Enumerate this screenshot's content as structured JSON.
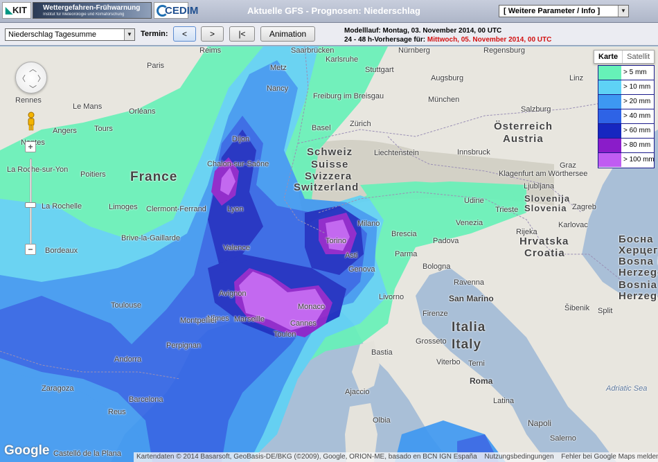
{
  "header": {
    "logo_kit": "KIT",
    "logo_wfw_title": "Wettergefahren-Frühwarnung",
    "logo_wfw_sub": "Institut für Meteorologie und Klimaforschung",
    "logo_cedim": "CEDIM",
    "title": "Aktuelle GFS - Prognosen: Niederschlag",
    "param_select": "[ Weitere Parameter / Info ]"
  },
  "controls": {
    "product_select": "Niederschlag Tagesumme",
    "termin_label": "Termin:",
    "btn_back": "<",
    "btn_forward": ">",
    "btn_first": "|<",
    "btn_animation": "Animation",
    "run_line": "Modelllauf: Montag, 03. November 2014, 00 UTC",
    "forecast_prefix": "24 - 48 h-Vorhersage für: ",
    "forecast_date": "Mittwoch, 05. November 2014, 00 UTC"
  },
  "map": {
    "maptype_karte": "Karte",
    "maptype_satellit": "Satellit",
    "zoom_plus": "+",
    "zoom_minus": "−",
    "google_logo": "Google",
    "attribution": "Kartendaten © 2014 Basarsoft, GeoBasis-DE/BKG (©2009), Google, ORION-ME, basado en BCN IGN España",
    "terms": "Nutzungsbedingungen",
    "report": "Fehler bei Google Maps melden",
    "countries": {
      "france": "France",
      "schweiz": "Schweiz",
      "suisse": "Suisse",
      "svizzera": "Svizzera",
      "switzerland": "Switzerland",
      "austria_de": "Österreich",
      "austria_en": "Austria",
      "italia": "Italia",
      "italy": "Italy",
      "liechtenstein": "Liechtenstein",
      "slovenia_sl": "Slovenija",
      "slovenia_en": "Slovenia",
      "croatia_hr": "Hrvatska",
      "croatia_en": "Croatia",
      "bih1": "Босна",
      "bih2": "Херцегов",
      "bih3": "Bosna i",
      "bih4": "Herzego",
      "bih5": "Bosnia",
      "bih6": "Herzego"
    },
    "cities": {
      "paris": "Paris",
      "reims": "Reims",
      "metz": "Metz",
      "nancy": "Nancy",
      "saarbrucken": "Saarbrücken",
      "karlsruhe": "Karlsruhe",
      "stuttgart": "Stuttgart",
      "augsburg": "Augsburg",
      "munchen": "München",
      "nurnberg": "Nürnberg",
      "regensburg": "Regensburg",
      "freiburg": "Freiburg im Breisgau",
      "basel": "Basel",
      "zurich": "Zürich",
      "salzburg": "Salzburg",
      "linz": "Linz",
      "graz": "Graz",
      "innsbruck": "Innsbruck",
      "klagenfurt": "Klagenfurt am Wörthersee",
      "ljubljana": "Ljubljana",
      "zagreb": "Zagreb",
      "karlovac": "Karlovac",
      "rijeka": "Rijeka",
      "udine": "Udine",
      "trieste": "Trieste",
      "rennes": "Rennes",
      "le_mans": "Le Mans",
      "orleans": "Orléans",
      "tours": "Tours",
      "angers": "Angers",
      "nantes": "Nantes",
      "poitiers": "Poitiers",
      "la_roche": "La Roche-sur-Yon",
      "la_rochelle": "La Rochelle",
      "limoges": "Limoges",
      "bordeaux": "Bordeaux",
      "dijon": "Dijon",
      "chalon": "Chalon-sur-Saône",
      "clermont": "Clermont-Ferrand",
      "brive": "Brive-la-Gaillarde",
      "lyon": "Lyon",
      "valence": "Valence",
      "nimes": "Nîmes",
      "avignon": "Avignon",
      "montpellier": "Montpellier",
      "marseille": "Marseille",
      "toulon": "Toulon",
      "cannes": "Cannes",
      "monaco": "Monaco",
      "toulouse": "Toulouse",
      "perpignan": "Perpignan",
      "andorra": "Andorra",
      "zaragoza": "Zaragoza",
      "barcelona": "Barcelona",
      "reus": "Reus",
      "castello": "Castelló de la Plana",
      "torino": "Torino",
      "milano": "Milano",
      "asti": "Asti",
      "genova": "Genova",
      "brescia": "Brescia",
      "venezia": "Venezia",
      "padova": "Padova",
      "parma": "Parma",
      "bologna": "Bologna",
      "ravenna": "Ravenna",
      "livorno": "Livorno",
      "san_marino": "San Marino",
      "firenze": "Firenze",
      "grosseto": "Grosseto",
      "terni": "Terni",
      "viterbo": "Viterbo",
      "roma": "Roma",
      "latina": "Latina",
      "napoli": "Napoli",
      "salerno": "Salerno",
      "olbia": "Olbia",
      "bastia": "Bastia",
      "ajaccio": "Ajaccio",
      "split": "Split",
      "sibenik": "Šibenik",
      "adriatic": "Adriatic Sea"
    },
    "legend": [
      {
        "label": "> 5 mm",
        "color": "#66f2b8"
      },
      {
        "label": "> 10 mm",
        "color": "#5ed2f5"
      },
      {
        "label": "> 20 mm",
        "color": "#3d98f2"
      },
      {
        "label": "> 40 mm",
        "color": "#2e63e6"
      },
      {
        "label": "> 60 mm",
        "color": "#1627c0"
      },
      {
        "label": "> 80 mm",
        "color": "#8a1cc9"
      },
      {
        "label": "> 100 mm",
        "color": "#c05cf2"
      }
    ]
  }
}
